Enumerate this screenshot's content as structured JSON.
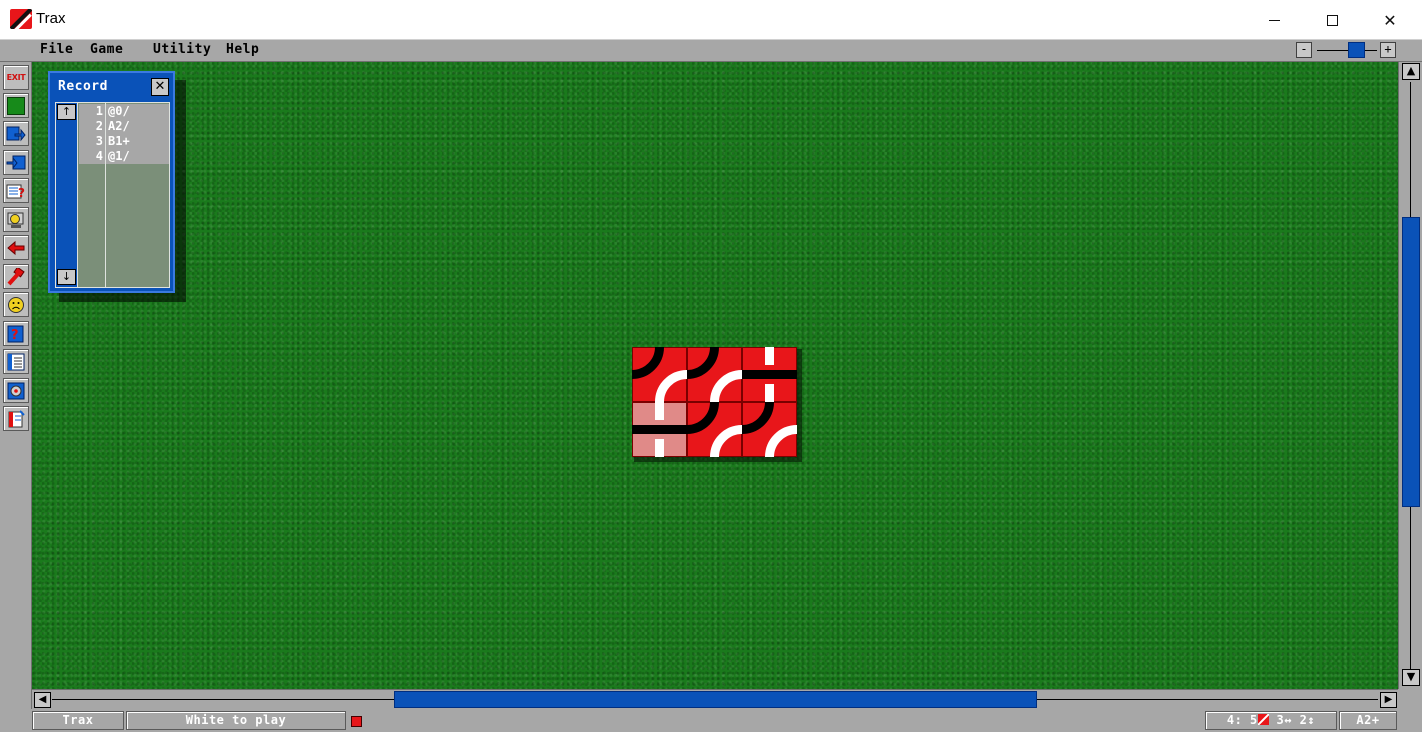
{
  "window": {
    "title": "Trax"
  },
  "menu": {
    "items": [
      "File",
      "Game",
      "Utility",
      "Help"
    ]
  },
  "zoom": {
    "minus_label": "-",
    "plus_label": "+"
  },
  "toolbar": {
    "exit_label": "EXIT",
    "tools": [
      "exit-icon",
      "green-square-icon",
      "blue-arrow-right-icon",
      "blue-arrow-in-icon",
      "checklist-question-icon",
      "face-screen-icon",
      "red-left-arrow-icon",
      "red-tool-icon",
      "sad-face-icon",
      "help-question-icon",
      "record-list-icon",
      "settings-gear-icon",
      "notebook-icon"
    ]
  },
  "record": {
    "title": "Record",
    "close_label": "✕",
    "scroll_up": "↑",
    "scroll_down": "↓",
    "moves": [
      {
        "num": "1",
        "move": "@0/"
      },
      {
        "num": "2",
        "move": "A2/"
      },
      {
        "num": "3",
        "move": "B1+"
      },
      {
        "num": "4",
        "move": "@1/"
      }
    ]
  },
  "board": {
    "columns": 3,
    "rows": 2,
    "tiles": [
      {
        "row": 0,
        "col": 0,
        "type": "curve",
        "rotation": 0,
        "highlight": false
      },
      {
        "row": 0,
        "col": 1,
        "type": "curve",
        "rotation": 0,
        "highlight": false
      },
      {
        "row": 0,
        "col": 2,
        "type": "cross",
        "rotation": 0,
        "highlight": false
      },
      {
        "row": 1,
        "col": 0,
        "type": "cross",
        "rotation": 0,
        "highlight": true
      },
      {
        "row": 1,
        "col": 1,
        "type": "curve",
        "rotation": 0,
        "highlight": false
      },
      {
        "row": 1,
        "col": 2,
        "type": "curve",
        "rotation": 0,
        "highlight": false
      }
    ],
    "colors": {
      "tile": "#e8161a",
      "tile_highlight": "#e08a88",
      "black_path": "#000000",
      "white_path": "#ffffff",
      "felt": "#1a7a1c"
    }
  },
  "scroll": {
    "up": "▲",
    "down": "▼",
    "left": "◀",
    "right": "▶"
  },
  "status": {
    "mode": "Trax",
    "message": "White to play",
    "counts": "4: 5",
    "counts_tail": " 3↔ 2↕",
    "last_move": "A2+"
  }
}
